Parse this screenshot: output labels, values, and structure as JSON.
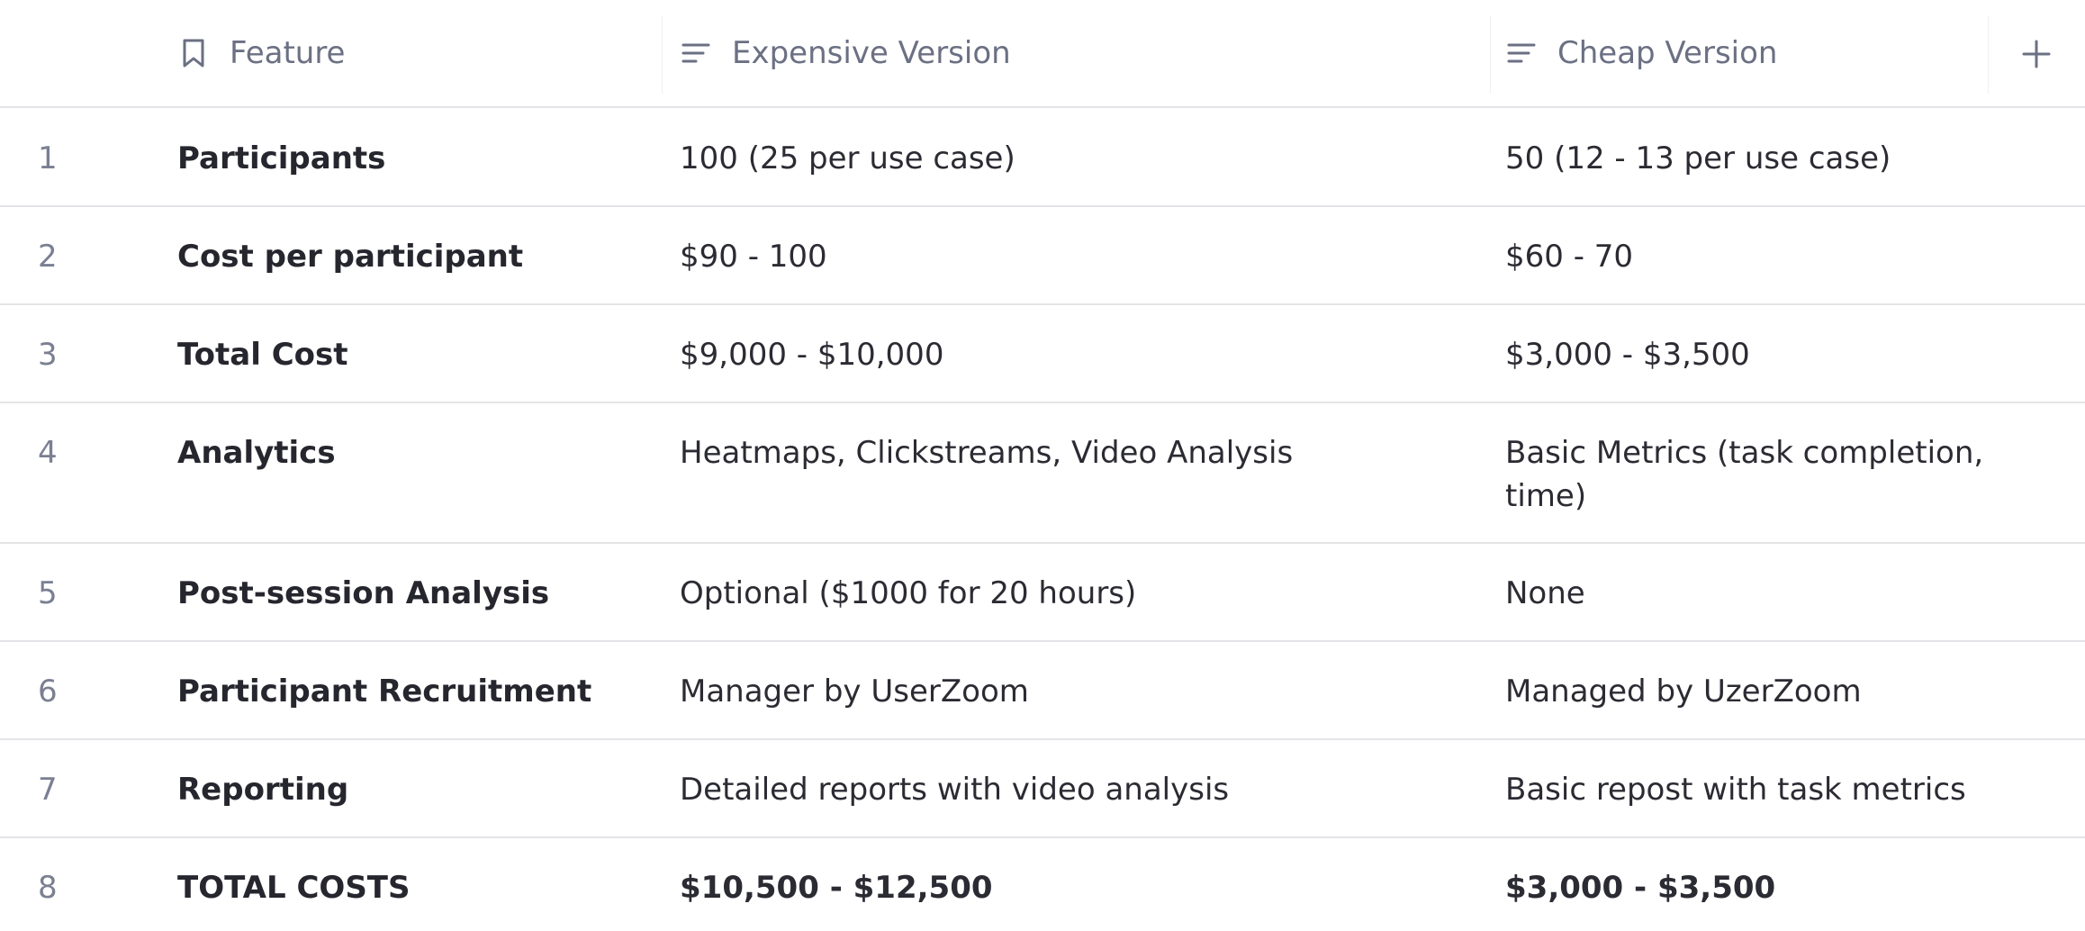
{
  "header": {
    "feature_label": "Feature",
    "expensive_label": "Expensive Version",
    "cheap_label": "Cheap Version",
    "feature_icon": "bookmark-icon",
    "text_icon": "text-lines-icon",
    "add_icon": "plus-icon"
  },
  "rows": [
    {
      "num": "1",
      "feature": "Participants",
      "expensive": "100 (25 per use case)",
      "cheap": "50 (12 - 13 per use case)"
    },
    {
      "num": "2",
      "feature": "Cost per participant",
      "expensive": "$90 - 100",
      "cheap": "$60 - 70"
    },
    {
      "num": "3",
      "feature": "Total Cost",
      "expensive": "$9,000 - $10,000",
      "cheap": "$3,000 - $3,500"
    },
    {
      "num": "4",
      "feature": "Analytics",
      "expensive": "Heatmaps, Clickstreams, Video Analysis",
      "cheap": "Basic Metrics (task completion, time)"
    },
    {
      "num": "5",
      "feature": "Post-session Analysis",
      "expensive": "Optional ($1000 for 20 hours)",
      "cheap": "None"
    },
    {
      "num": "6",
      "feature": "Participant Recruitment",
      "expensive": "Manager by UserZoom",
      "cheap": "Managed by UzerZoom"
    },
    {
      "num": "7",
      "feature": "Reporting",
      "expensive": "Detailed reports with video analysis",
      "cheap": "Basic repost with task metrics"
    },
    {
      "num": "8",
      "feature": "TOTAL COSTS",
      "expensive": "$10,500 - $12,500",
      "cheap": "$3,000 - $3,500"
    }
  ],
  "colors": {
    "header_text": "#6b7083",
    "border": "#e4e4e8",
    "body_text": "#2b2b33",
    "row_number": "#7a7f92"
  }
}
